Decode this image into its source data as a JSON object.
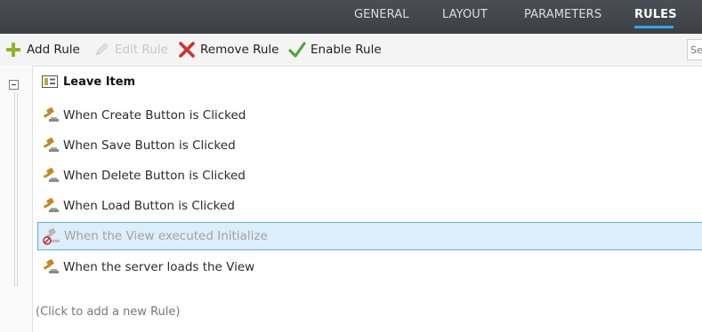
{
  "tabs": [
    {
      "label": "GENERAL",
      "active": false
    },
    {
      "label": "LAYOUT",
      "active": false
    },
    {
      "label": "PARAMETERS",
      "active": false
    },
    {
      "label": "RULES",
      "active": true
    }
  ],
  "toolbar": {
    "add_rule": "Add Rule",
    "edit_rule": "Edit Rule",
    "remove_rule": "Remove Rule",
    "enable_rule": "Enable Rule",
    "search_placeholder": "Se"
  },
  "tree": {
    "item_title": "Leave Item",
    "item_icon": "form-view-icon",
    "rules": [
      {
        "label": "When Create Button is Clicked",
        "icon": "gavel-icon",
        "enabled": true,
        "selected": false
      },
      {
        "label": "When Save Button is Clicked",
        "icon": "gavel-icon",
        "enabled": true,
        "selected": false
      },
      {
        "label": "When Delete Button is Clicked",
        "icon": "gavel-icon",
        "enabled": true,
        "selected": false
      },
      {
        "label": "When Load Button is Clicked",
        "icon": "gavel-icon",
        "enabled": true,
        "selected": false
      },
      {
        "label": "When the View executed Initialize",
        "icon": "gavel-disabled-icon",
        "enabled": false,
        "selected": true
      },
      {
        "label": "When the server loads the View",
        "icon": "gavel-icon",
        "enabled": true,
        "selected": false
      }
    ],
    "add_hint": "(Click to add a new Rule)"
  },
  "colors": {
    "tabbar_bg": "#3f4449",
    "active_tab_underline": "#2aa9e6",
    "selected_row_bg": "#dbeefa",
    "selected_row_border": "#5aaee8",
    "add_icon": "#8db530",
    "remove_icon": "#d0312d",
    "enable_icon": "#4aa83a",
    "gavel_icon": "#c8861e"
  }
}
